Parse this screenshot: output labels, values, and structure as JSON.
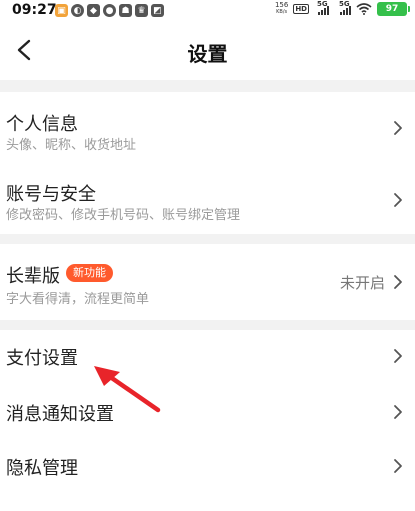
{
  "status_bar": {
    "time": "09:27",
    "net_speed_value": "156",
    "net_speed_unit": "KB/s",
    "hd": "HD",
    "sig1": "5G",
    "sig2": "5G",
    "battery": "97",
    "battery_color": "#35c04b"
  },
  "header": {
    "title": "设置"
  },
  "items": [
    {
      "title": "个人信息",
      "subtitle": "头像、昵称、收货地址"
    },
    {
      "title": "账号与安全",
      "subtitle": "修改密码、修改手机号码、账号绑定管理"
    },
    {
      "title": "长辈版",
      "badge": "新功能",
      "subtitle": "字大看得清，流程更简单",
      "value": "未开启"
    },
    {
      "title": "支付设置"
    },
    {
      "title": "消息通知设置"
    },
    {
      "title": "隐私管理"
    }
  ],
  "colors": {
    "badge": "#ff5a2d",
    "annotation_arrow": "#e8242a",
    "section_gap": "#f2f2f2"
  }
}
